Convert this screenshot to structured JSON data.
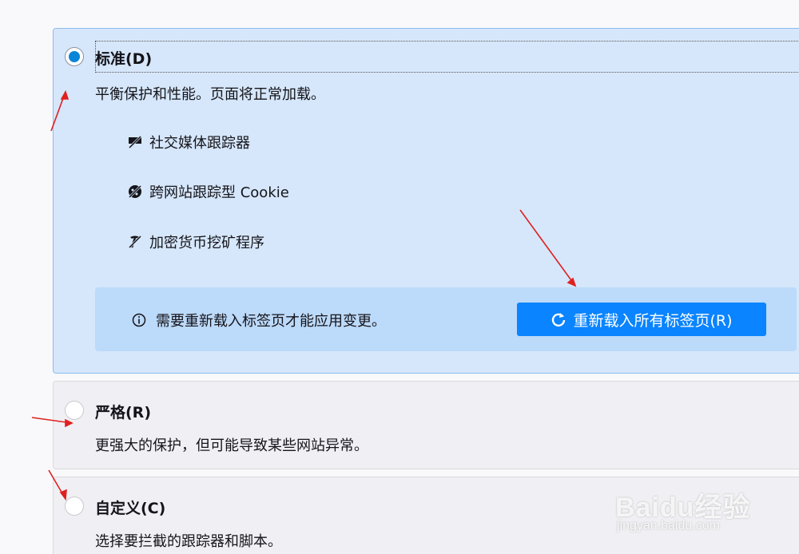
{
  "options": {
    "standard": {
      "title": "标准(D)",
      "description": "平衡保护和性能。页面将正常加载。",
      "checked": true,
      "trackers": [
        {
          "label": "社交媒体跟踪器",
          "icon": "social-tracker-icon"
        },
        {
          "label": "跨网站跟踪型 Cookie",
          "icon": "cookie-icon"
        },
        {
          "label": "加密货币挖矿程序",
          "icon": "cryptominer-icon"
        }
      ],
      "reload": {
        "message": "需要重新载入标签页才能应用变更。",
        "button_label": "重新载入所有标签页(R)",
        "info_icon": "info-icon",
        "button_icon": "reload-icon"
      }
    },
    "strict": {
      "title": "严格(R)",
      "description": "更强大的保护，但可能导致某些网站异常。",
      "checked": false
    },
    "custom": {
      "title": "自定义(C)",
      "description": "选择要拦截的跟踪器和脚本。",
      "checked": false
    }
  },
  "watermark": {
    "logo": "Baidu经验",
    "url": "jingyan.baidu.com"
  },
  "colors": {
    "selected_bg": "#d6e7fb",
    "selected_border": "#8cbcf0",
    "reload_bar_bg": "#bcdaf9",
    "button_bg": "#0a84ff",
    "radio_checked": "#0a84d8",
    "annotation_arrow": "#e02020"
  }
}
